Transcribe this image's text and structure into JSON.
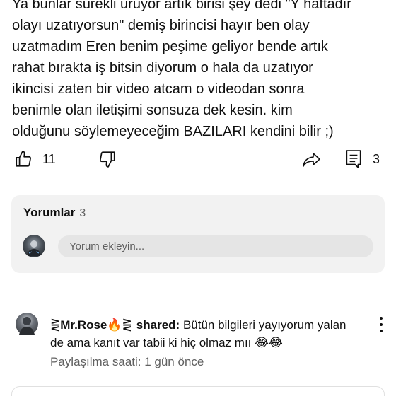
{
  "post": {
    "lines": [
      "Ya bunlar sürekli uruyor artık birisi şey dedi \"Y haftadır",
      "olayı uzatıyorsun\" demiş birincisi hayır ben olay",
      "uzatmadım Eren benim peşime geliyor bende artık",
      "rahat bırakta iş bitsin diyorum o hala da uzatıyor",
      "ikincisi zaten bir video atcam o videodan sonra",
      "benimle olan iletişimi sonsuza dek kesin. kim",
      "olduğunu söylemeyeceğim BAZILARI kendini bilir ;)"
    ]
  },
  "actions": {
    "like_icon": "thumbs-up-icon",
    "like_count": "11",
    "dislike_icon": "thumbs-down-icon",
    "share_icon": "share-arrow-icon",
    "comment_icon": "comment-icon",
    "comment_count": "3"
  },
  "comments_section": {
    "title": "Yorumlar",
    "count": "3",
    "input_placeholder": "Yorum ekleyin..."
  },
  "shared_post": {
    "author": "⋛Mr.Rose🔥⋛",
    "shared_label": "shared:",
    "text": "Bütün bilgileri yayıyorum yalan de ama kanıt var tabii ki hiç olmaz mıı 😂😂",
    "time": "Paylaşılma saati: 1 gün önce"
  }
}
